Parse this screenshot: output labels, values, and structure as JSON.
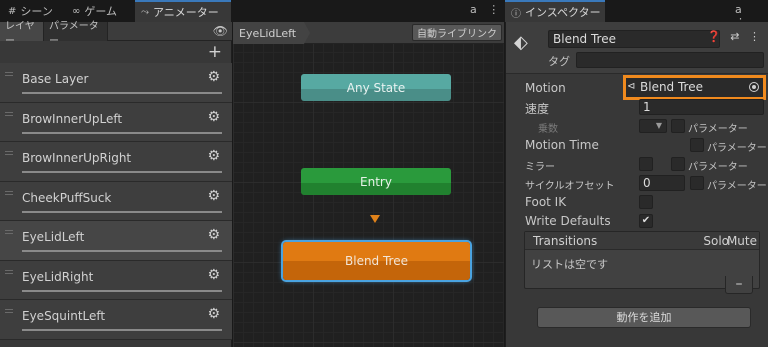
{
  "tabs": [
    {
      "icon": "#",
      "label": "シーン"
    },
    {
      "icon": "∞",
      "label": "ゲーム"
    },
    {
      "icon": "⤳",
      "label": "アニメーター"
    }
  ],
  "inspector_tab": {
    "icon": "ⓘ",
    "label": "インスペクター"
  },
  "window_icons": "a ⋮",
  "layers_panel": {
    "subtabs": [
      "レイヤー",
      "パラメーター"
    ],
    "add_label": "+",
    "layers": [
      "Base Layer",
      "BrowInnerUpLeft",
      "BrowInnerUpRight",
      "CheekPuffSuck",
      "EyeLidLeft",
      "EyeLidRight",
      "EyeSquintLeft"
    ],
    "selected_index": 4
  },
  "graph": {
    "breadcrumb": "EyeLidLeft",
    "auto_live": "自動ライブリンク",
    "nodes": {
      "any_state": "Any State",
      "entry": "Entry",
      "blend_tree": "Blend Tree"
    }
  },
  "inspector": {
    "object_name": "Blend Tree",
    "tag_label": "タグ",
    "header_icons": "❓ ⇄ ⋮",
    "motion_label": "Motion",
    "motion_value": "Blend Tree",
    "speed_label": "速度",
    "speed_value": "1",
    "multiplier_label": "乗数",
    "param_label": "パラメーター",
    "motion_time_label": "Motion Time",
    "mirror_label": "ミラー",
    "cycle_offset_label": "サイクルオフセット",
    "cycle_offset_value": "0",
    "foot_ik_label": "Foot IK",
    "write_defaults_label": "Write Defaults",
    "write_defaults_checked": "✔",
    "transitions_title": "Transitions",
    "solo_label": "Solo",
    "mute_label": "Mute",
    "empty_list": "リストは空です",
    "minus_label": "–",
    "add_behaviour": "動作を追加"
  },
  "colors": {
    "highlight_border": "#f08a1e",
    "any_state": "#57a9a2",
    "entry": "#2a9a3c",
    "blend_tree": "#e07a12",
    "selection": "#4aa3e0"
  }
}
